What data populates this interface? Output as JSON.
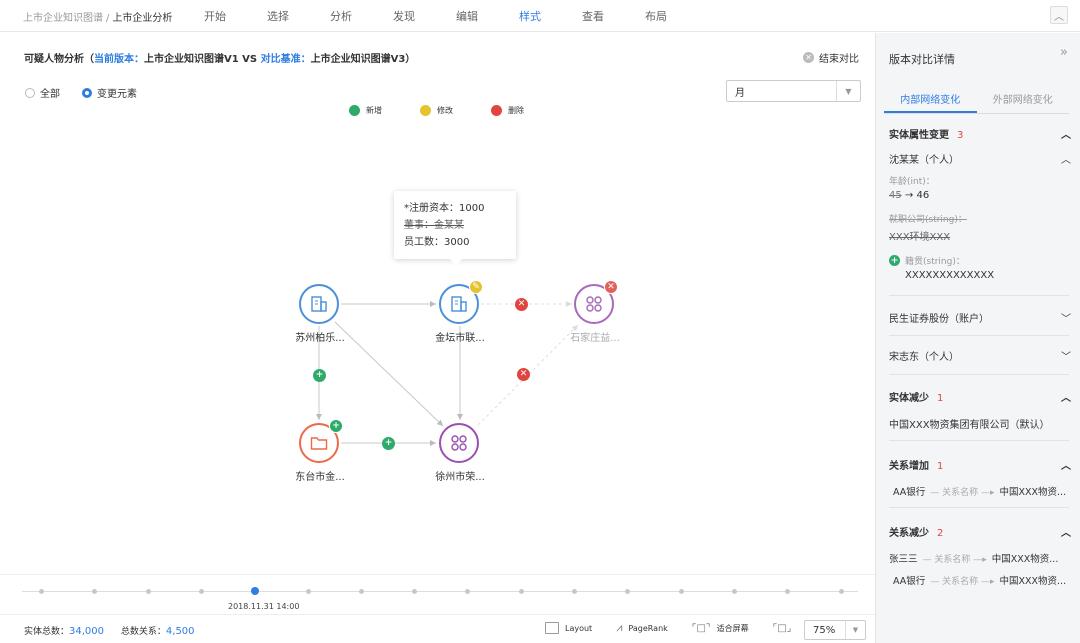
{
  "breadcrumb": {
    "parent": "上市企业知识图谱",
    "separator": "/",
    "current": "上市企业分析"
  },
  "menu": [
    {
      "label": "开始",
      "active": false
    },
    {
      "label": "选择",
      "active": false
    },
    {
      "label": "分析",
      "active": false
    },
    {
      "label": "发现",
      "active": false
    },
    {
      "label": "编辑",
      "active": false
    },
    {
      "label": "样式",
      "active": true
    },
    {
      "label": "查看",
      "active": false
    },
    {
      "label": "布局",
      "active": false
    }
  ],
  "header": {
    "prefix": "可疑人物分析（",
    "current_label": "当前版本：",
    "current_value": "上市企业知识图谱V1",
    "vs": " VS ",
    "base_label": "对比基准：",
    "base_value": "上市企业知识图谱V3）",
    "end_compare": "结束对比"
  },
  "filters": {
    "all_label": "全部",
    "changed_label": "变更元素",
    "period_value": "月"
  },
  "legend": [
    {
      "label": "新增",
      "color": "#2eaa6a"
    },
    {
      "label": "修改",
      "color": "#e5c32f"
    },
    {
      "label": "删除",
      "color": "#e0463f"
    }
  ],
  "nodes": {
    "suzhou": "苏州柏乐...",
    "jintan": "金坛市联...",
    "shijiazhuang": "石家庄益...",
    "dongtai": "东台市金...",
    "xuzhou": "徐州市荣..."
  },
  "tooltip": {
    "line1": "*注册资本：1000",
    "line2": "董事：金某某",
    "line3": "员工数：3000"
  },
  "timeline": {
    "date": "2018.11.31 14:00"
  },
  "footer": {
    "entity_total_label": "实体总数：",
    "entity_total": "34,000",
    "relation_total_label": "总数关系：",
    "relation_total": "4,500",
    "layout": "Layout",
    "pagerank": "PageRank",
    "fit": "适合屏幕",
    "zoom": "75%"
  },
  "panel": {
    "title": "版本对比详情",
    "tab_internal": "内部网络变化",
    "tab_external": "外部网络变化",
    "attr_change": {
      "title": "实体属性变更",
      "count": "3"
    },
    "person1": {
      "name": "沈某某（个人）",
      "age_label": "年龄(int)：",
      "age_old": "45",
      "age_arrow": "→",
      "age_new": "46",
      "job_label": "就职公司(string)：",
      "job_value": "XXX环境XXX",
      "native_label": "籍贯(string)：",
      "native_value": "XXXXXXXXXXXXX"
    },
    "item2": "民生证券股份（账户）",
    "item3": "宋志东（个人）",
    "entity_decrease": {
      "title": "实体减少",
      "count": "1",
      "item": "中国XXX物资集团有限公司（默认）"
    },
    "relation_increase": {
      "title": "关系增加",
      "count": "1",
      "from": "AA银行",
      "mid": "— 关系名称 —▸",
      "to": "中国XXX物资..."
    },
    "relation_decrease": {
      "title": "关系减少",
      "count": "2",
      "r1_from": "张三三",
      "r1_mid": "— 关系名称 —▸",
      "r1_to": "中国XXX物资...",
      "r2_from": "AA银行",
      "r2_mid": "— 关系名称 —▸",
      "r2_to": "中国XXX物资..."
    }
  },
  "colors": {
    "accent": "#2f7de1",
    "added": "#2eaa6a",
    "modified": "#e5c32f",
    "deleted": "#e0463f",
    "company": "#4a90d9",
    "purple": "#9b4fb0",
    "orange": "#ec6a4a"
  }
}
